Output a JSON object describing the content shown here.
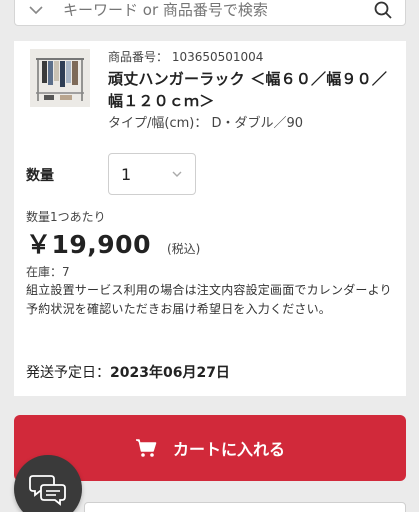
{
  "search": {
    "placeholder": "キーワード or 商品番号で検索"
  },
  "product": {
    "number": "商品番号： 103650501004",
    "title": "頑丈ハンガーラック ＜幅６０／幅９０／幅１２０ｃｍ＞",
    "type": "タイプ/幅(cm)： D・ダブル／90"
  },
  "quantity": {
    "label": "数量",
    "value": "1"
  },
  "price": {
    "unit_note": "数量1つあたり",
    "amount": "￥19,900",
    "tax_note": "(税込)"
  },
  "stock": "在庫：7",
  "assembly_note": "組立設置サービス利用の場合は注文内容設定画面でカレンダーより予約状況を確認いただきお届け希望日を入力ください。",
  "shipping": {
    "label": "発送予定日：",
    "date": "2023年06月27日"
  },
  "cart_button": {
    "label": "カートに入れる"
  },
  "colors": {
    "accent": "#d1293a",
    "chat_fab": "#3a3a3a"
  },
  "icons": [
    "chevron-down-icon",
    "search-icon",
    "cart-icon",
    "chat-icon"
  ]
}
